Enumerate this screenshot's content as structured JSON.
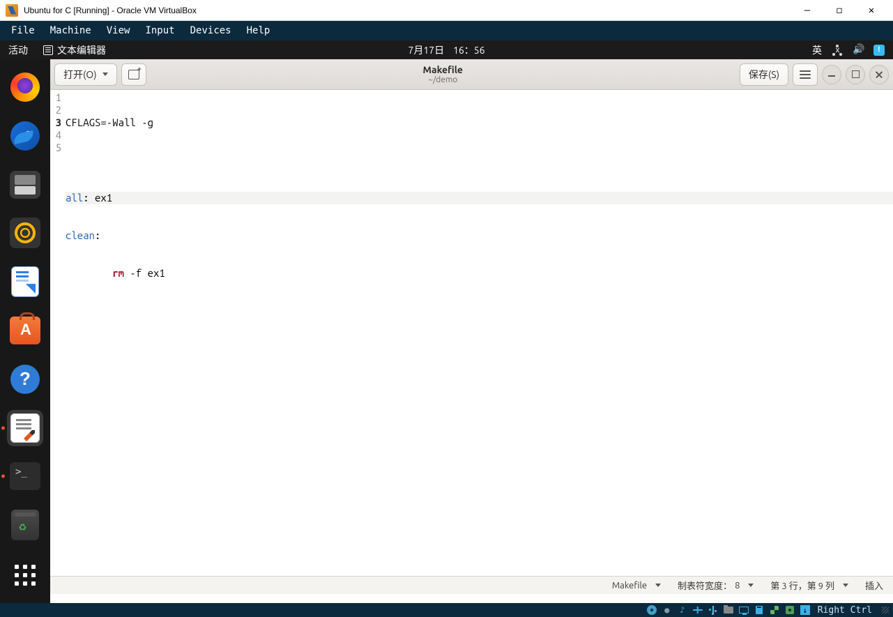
{
  "vbox": {
    "title": "Ubuntu for C [Running] - Oracle VM VirtualBox",
    "menu": {
      "file": "File",
      "machine": "Machine",
      "view": "View",
      "input": "Input",
      "devices": "Devices",
      "help": "Help"
    },
    "hostkey": "Right Ctrl"
  },
  "gnome": {
    "activities": "活动",
    "app_name": "文本编辑器",
    "clock_date": "7月17日",
    "clock_time": "16：56",
    "ime": "英"
  },
  "dock": {
    "firefox": "firefox",
    "thunderbird": "thunderbird",
    "files": "files",
    "rhythmbox": "rhythmbox",
    "writer": "libreoffice-writer",
    "software": "ubuntu-software",
    "help": "help",
    "gedit": "text-editor",
    "terminal": "terminal",
    "trash": "trash",
    "apps": "show-applications"
  },
  "gedit": {
    "open_label": "打开(O)",
    "title": "Makefile",
    "subtitle": "~/demo",
    "save_label": "保存(S)",
    "lines": {
      "l1": "CFLAGS=-Wall -g",
      "l2": "",
      "l3_target": "all",
      "l3_rest": ": ex1",
      "l4_target": "clean",
      "l4_rest": ":",
      "l5_indent": "        ",
      "l5_cmd": "rm",
      "l5_rest": " -f ex1"
    },
    "line_numbers": {
      "n1": "1",
      "n2": "2",
      "n3": "3",
      "n4": "4",
      "n5": "5"
    },
    "status": {
      "syntax": "Makefile",
      "tabwidth_label": "制表符宽度：",
      "tabwidth_value": "8",
      "cursor": "第 3 行，第 9 列",
      "insert_mode": "插入"
    }
  }
}
